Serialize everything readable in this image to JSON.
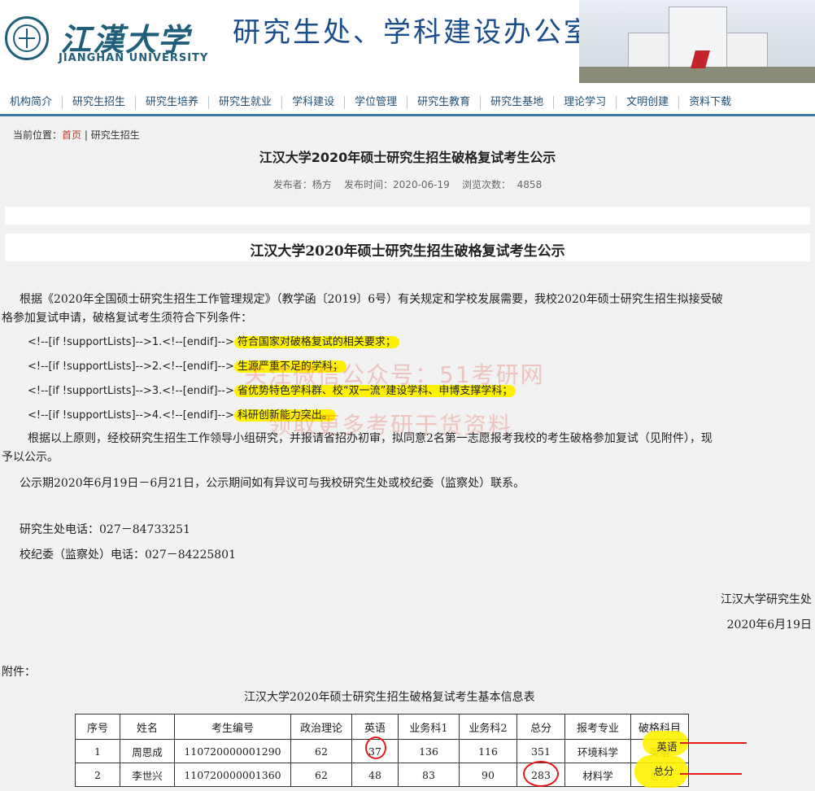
{
  "header": {
    "logo_cn": "江漢大学",
    "logo_en": "JIANGHAN UNIVERSITY",
    "site_title": "研究生处、学科建设办公室"
  },
  "nav": {
    "items": [
      "机构简介",
      "研究生招生",
      "研究生培养",
      "研究生就业",
      "学科建设",
      "学位管理",
      "研究生教育",
      "研究生基地",
      "理论学习",
      "文明创建",
      "资料下载"
    ]
  },
  "breadcrumb": {
    "prefix": "当前位置：",
    "home": "首页",
    "separator": " | ",
    "current": "研究生招生"
  },
  "article": {
    "title": "江汉大学2020年硕士研究生招生破格复试考生公示",
    "meta": "发布者：杨方    发布时间：2020-06-19    浏览次数：  4858",
    "inner_title": "江汉大学2020年硕士研究生招生破格复试考生公示",
    "intro_line1": "根据《2020年全国硕士研究生招生工作管理规定》（教学函〔2019〕6号）有关规定和学校发展需要，我校2020年硕士研究生招生拟接受破",
    "intro_line2": "格参加复试申请，破格复试考生须符合下列条件：",
    "conditions": [
      {
        "prefix": "<!--[if !supportLists]-->1.<!--[endif]-->",
        "text": "符合国家对破格复试的相关要求；"
      },
      {
        "prefix": "<!--[if !supportLists]-->2.<!--[endif]-->",
        "text": "生源严重不足的学科；"
      },
      {
        "prefix": "<!--[if !supportLists]-->3.<!--[endif]-->",
        "text": "省优势特色学科群、校“双一流”建设学科、申博支撑学科；"
      },
      {
        "prefix": "<!--[if !supportLists]-->4.<!--[endif]-->",
        "text": "科研创新能力突出。"
      }
    ],
    "decision_line1": "根据以上原则，经校研究生招生工作领导小组研究，并报请省招办初审，拟同意2名第一志愿报考我校的考生破格参加复试（见附件），现",
    "decision_line2": "予以公示。",
    "period": "公示期2020年6月19日－6月21日，公示期间如有异议可与我校研究生处或校纪委（监察处）联系。",
    "phone1": "研究生处电话：027－84733251",
    "phone2": "校纪委（监察处）电话：027－84225801",
    "signature": "江汉大学研究生处",
    "date": "2020年6月19日",
    "attachment_label": "附件：",
    "table_caption": "江汉大学2020年硕士研究生招生破格复试考生基本信息表"
  },
  "watermark": {
    "line1": "关注微信公众号：51考研网",
    "line2": "领取更多考研干货资料"
  },
  "table": {
    "headers": [
      "序号",
      "姓名",
      "考生编号",
      "政治理论",
      "英语",
      "业务科1",
      "业务科2",
      "总分",
      "报考专业",
      "破格科目"
    ],
    "rows": [
      [
        "1",
        "周思成",
        "110720000001290",
        "62",
        "37",
        "136",
        "116",
        "351",
        "环境科学",
        "英语"
      ],
      [
        "2",
        "李世兴",
        "110720000001360",
        "62",
        "48",
        "83",
        "90",
        "283",
        "材料学",
        "总分"
      ]
    ]
  },
  "colors": {
    "brand": "#1f5f7a",
    "nav_text": "#1f4f74",
    "highlight": "#fff200",
    "annotation_red": "#e51919"
  }
}
